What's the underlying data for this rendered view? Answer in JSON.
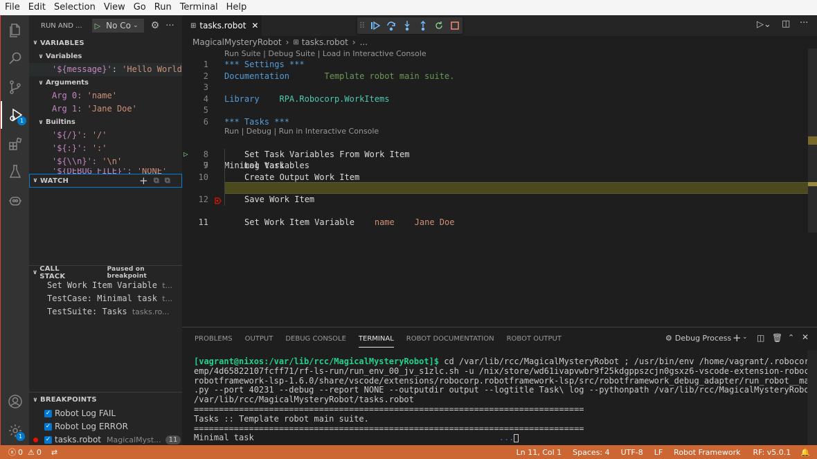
{
  "menu": [
    "File",
    "Edit",
    "Selection",
    "View",
    "Go",
    "Run",
    "Terminal",
    "Help"
  ],
  "activity": {
    "run_debug_badge": "1",
    "accounts_badge": "1"
  },
  "sidebar": {
    "header": "RUN AND ...",
    "config_select": "No Co",
    "variables_title": "VARIABLES",
    "variables_group": "Variables",
    "variables": [
      {
        "name": "'${message}'",
        "value": "'Hello World!'"
      }
    ],
    "arguments_group": "Arguments",
    "arguments": [
      {
        "name": "Arg 0:",
        "value": "'name'"
      },
      {
        "name": "Arg 1:",
        "value": "'Jane Doe'"
      }
    ],
    "builtins_group": "Builtins",
    "builtins": [
      {
        "name": "'${/}':",
        "value": "'/'"
      },
      {
        "name": "'${:}':",
        "value": "':'"
      },
      {
        "name": "'${\\\\n}':",
        "value": "'\\n'"
      },
      {
        "name": "'${DEBUG_FILE}':",
        "value": "'NONE'"
      }
    ],
    "watch_title": "WATCH",
    "callstack_title": "CALL STACK",
    "callstack_status": "Paused on breakpoint",
    "callstack": [
      {
        "name": "Set Work Item Variable",
        "file": "t..."
      },
      {
        "name": "TestCase: Minimal task",
        "file": "t..."
      },
      {
        "name": "TestSuite: Tasks",
        "file": "tasks.ro..."
      }
    ],
    "breakpoints_title": "BREAKPOINTS",
    "breakpoints": [
      {
        "label": "Robot Log FAIL",
        "path": "",
        "count": ""
      },
      {
        "label": "Robot Log ERROR",
        "path": "",
        "count": ""
      },
      {
        "label": "tasks.robot",
        "path": "MagicalMyst...",
        "count": "11"
      }
    ]
  },
  "editor": {
    "tab_label": "tasks.robot",
    "breadcrumb": {
      "folder": "MagicalMysteryRobot",
      "file": "tasks.robot",
      "more": "..."
    },
    "codelens_suite": "Run Suite | Debug Suite | Load in Interactive Console",
    "codelens_task": "Run | Debug | Run in Interactive Console",
    "lines": {
      "l1": "*** Settings ***",
      "l2_kw": "Documentation",
      "l2_val": "Template robot main suite.",
      "l4_kw": "Library",
      "l4_val": "RPA.Robocorp.WorkItems",
      "l6": "*** Tasks ***",
      "l7": "Minimal task",
      "l8": "Set Task Variables From Work Item",
      "l9": "Log Variables",
      "l10": "Create Output Work Item",
      "l11_kw": "Set Work Item Variable",
      "l11_a1": "name",
      "l11_a2": "Jane Doe",
      "l12": "Save Work Item"
    },
    "line_numbers": [
      "1",
      "2",
      "3",
      "4",
      "5",
      "6",
      "7",
      "8",
      "9",
      "10",
      "11",
      "12"
    ]
  },
  "panel": {
    "tabs": [
      "PROBLEMS",
      "OUTPUT",
      "DEBUG CONSOLE",
      "TERMINAL",
      "ROBOT DOCUMENTATION",
      "ROBOT OUTPUT"
    ],
    "active_tab": "TERMINAL",
    "terminal_select": "Debug Process",
    "terminal": {
      "prompt": "[vagrant@nixos:/var/lib/rcc/MagicalMysteryRobot]$",
      "cmd_1": " cd /var/lib/rcc/MagicalMysteryRobot ; /usr/bin/env /home/vagrant/.robocorp/t",
      "cmd_2": "emp/4d65822107fcff71/rf-ls-run/run_env_00_jv_s1zlc.sh -u /nix/store/wd61ivapvwbr9f25kdgppszcjn0gsxz6-vscode-extension-robocorp-",
      "cmd_3": "robotframework-lsp-1.6.0/share/vscode/extensions/robocorp.robotframework-lsp/src/robotframework_debug_adapter/run_robot__main__",
      "cmd_4": ".py --port 40231 --debug --report NONE --outputdir output --logtitle Task\\ log --pythonpath /var/lib/rcc/MagicalMysteryRobot/.",
      "cmd_5": "/var/lib/rcc/MagicalMysteryRobot/tasks.robot",
      "sep": "==============================================================================",
      "suite": "Tasks :: Template robot main suite.",
      "task": "Minimal task",
      "dots": "..."
    }
  },
  "status": {
    "errors": "0",
    "warnings": "0",
    "position": "Ln 11, Col 1",
    "spaces": "Spaces: 4",
    "encoding": "UTF-8",
    "eol": "LF",
    "language": "Robot Framework",
    "rf_version": "RF: v5.0.1"
  },
  "colors": {
    "status_bar": "#cc6633",
    "accent": "#007acc",
    "debug_line": "#4b4a1e"
  }
}
